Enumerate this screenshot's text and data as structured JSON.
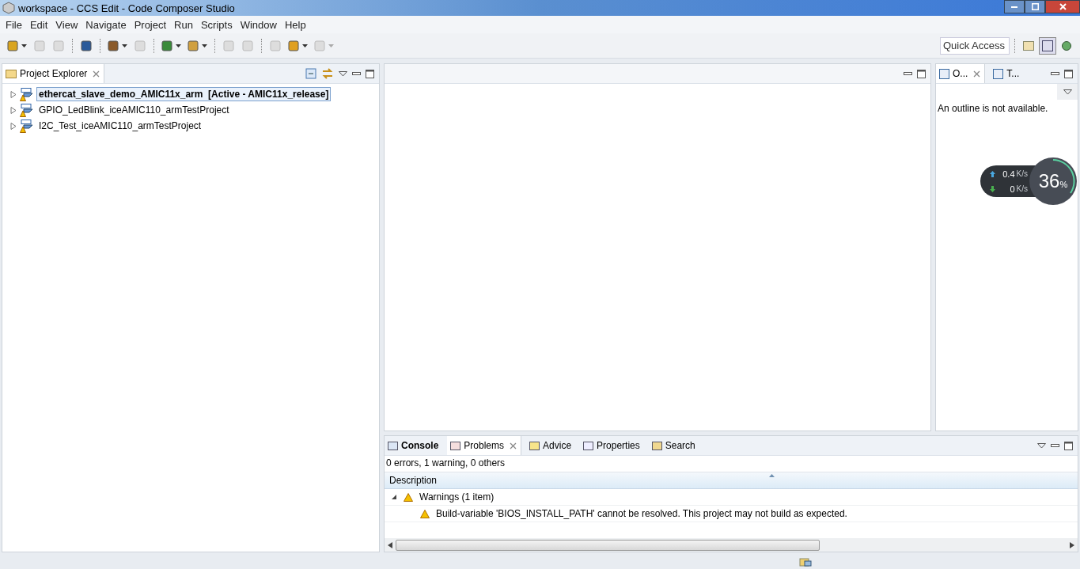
{
  "window": {
    "title": "workspace - CCS Edit - Code Composer Studio"
  },
  "menu": [
    "File",
    "Edit",
    "View",
    "Navigate",
    "Project",
    "Run",
    "Scripts",
    "Window",
    "Help"
  ],
  "toolbar": [
    {
      "disabled": false,
      "dropdown": true
    },
    {
      "disabled": true,
      "dropdown": false
    },
    {
      "disabled": true,
      "dropdown": false
    },
    {
      "disabled": false,
      "dropdown": false
    },
    {
      "disabled": false,
      "dropdown": true
    },
    {
      "disabled": true,
      "dropdown": false
    },
    {
      "disabled": false,
      "dropdown": true
    },
    {
      "disabled": false,
      "dropdown": true
    },
    {
      "disabled": true,
      "dropdown": false
    },
    {
      "disabled": true,
      "dropdown": false
    },
    {
      "disabled": true,
      "dropdown": false
    },
    {
      "disabled": false,
      "dropdown": true
    },
    {
      "disabled": true,
      "dropdown": true
    }
  ],
  "quick_access": {
    "placeholder": "Quick Access"
  },
  "project_explorer": {
    "title": "Project Explorer",
    "items": [
      {
        "name": "ethercat_slave_demo_AMIC11x_arm",
        "suffix": "[Active - AMIC11x_release]",
        "selected": true,
        "expanded": false
      },
      {
        "name": "GPIO_LedBlink_iceAMIC110_armTestProject",
        "selected": false,
        "expanded": false
      },
      {
        "name": "I2C_Test_iceAMIC110_armTestProject",
        "selected": false,
        "expanded": false
      }
    ]
  },
  "outline_panel": {
    "tabs": [
      {
        "label": "O...",
        "selected": true
      },
      {
        "label": "T...",
        "selected": false
      }
    ],
    "message": "An outline is not available."
  },
  "network_widget": {
    "upload": "0.4",
    "upload_unit": "K/s",
    "download": "0",
    "download_unit": "K/s",
    "cpu": "36",
    "cpu_unit": "%"
  },
  "bottom_panel": {
    "tabs": [
      {
        "label": "Console",
        "selected": false,
        "bold": true
      },
      {
        "label": "Problems",
        "selected": true,
        "bold": false
      },
      {
        "label": "Advice",
        "selected": false,
        "bold": false
      },
      {
        "label": "Properties",
        "selected": false,
        "bold": false
      },
      {
        "label": "Search",
        "selected": false,
        "bold": false
      }
    ],
    "summary": "0 errors, 1 warning, 0 others",
    "column": "Description",
    "groups": [
      {
        "label": "Warnings (1 item)",
        "expanded": true,
        "children": [
          {
            "label": "Build-variable 'BIOS_INSTALL_PATH' cannot be resolved. This project may not build as expected."
          }
        ]
      }
    ]
  }
}
